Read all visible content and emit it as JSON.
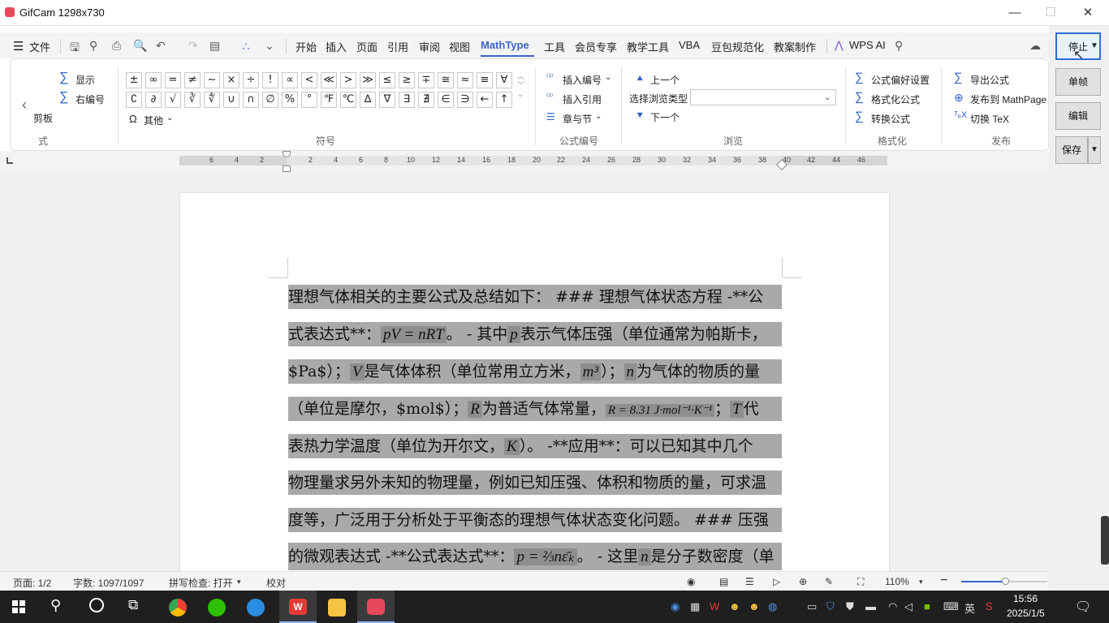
{
  "window": {
    "title": "GifCam 1298x730"
  },
  "menu": {
    "file": "文件",
    "items": [
      "开始",
      "插入",
      "页面",
      "引用",
      "审阅",
      "视图",
      "MathType",
      "工具",
      "会员专享",
      "教学工具",
      "VBA",
      "豆包规范化",
      "教案制作"
    ],
    "ai": "WPS AI"
  },
  "ribbon": {
    "left": {
      "show": "显示",
      "right_number": "右编号",
      "clip_partial": "剪板",
      "style_partial": "式"
    },
    "symbols": {
      "row1": [
        "±",
        "∞",
        "=",
        "≠",
        "~",
        "×",
        "÷",
        "!",
        "∝",
        "<",
        "≪",
        ">",
        "≫",
        "≤",
        "≥",
        "∓",
        "≅",
        "≈",
        "≡",
        "∀"
      ],
      "row2": [
        "∁",
        "∂",
        "√",
        "∛",
        "∜",
        "∪",
        "∩",
        "∅",
        "%",
        "°",
        "℉",
        "℃",
        "∆",
        "∇",
        "∃",
        "∄",
        "∈",
        "∋",
        "←",
        "↑"
      ],
      "other": "其他",
      "caption": "符号"
    },
    "numbering": {
      "insert_number": "插入编号",
      "insert_ref": "插入引用",
      "chapter": "章与节",
      "caption": "公式编号"
    },
    "browse": {
      "prev": "上一个",
      "select_type": "选择浏览类型",
      "next": "下一个",
      "caption": "浏览"
    },
    "format": {
      "prefs": "公式偏好设置",
      "format_eq": "格式化公式",
      "convert": "转换公式",
      "caption": "格式化"
    },
    "publish": {
      "export": "导出公式",
      "mathpage": "发布到 MathPage",
      "tex": "切换 TeX",
      "caption": "发布"
    }
  },
  "ruler": {
    "ticks_left": [
      "6",
      "4",
      "2"
    ],
    "ticks_right": [
      "2",
      "4",
      "6",
      "8",
      "10",
      "12",
      "14",
      "16",
      "18",
      "20",
      "22",
      "24",
      "26",
      "28",
      "30",
      "32",
      "34",
      "36",
      "38",
      "40",
      "42",
      "44",
      "46"
    ]
  },
  "doc": {
    "l1": "理想气体相关的主要公式及总结如下： ### 理想气体状态方程 -**公",
    "l2a": "式表达式**：",
    "l2eq": "pV = nRT",
    "l2b": "。 - 其中",
    "l2p": "p",
    "l2c": "表示气体压强（单位通常为帕斯卡，",
    "l3a": "$Pa$）；",
    "l3V": "V",
    "l3b": "是气体体积（单位常用立方米，",
    "l3m": "m³",
    "l3c": "）；",
    "l3n": "n",
    "l3d": "为气体的物质的量",
    "l4a": "（单位是摩尔，$mol$）；",
    "l4R": "R",
    "l4b": "为普适气体常量，",
    "l4eq": "R = 8.31 J·mol⁻¹·K⁻¹",
    "l4c": "；",
    "l4T": "T",
    "l4d": "代",
    "l5a": "表热力学温度（单位为开尔文，",
    "l5K": "K",
    "l5b": "）。 -**应用**：可以已知其中几个",
    "l6": "物理量求另外未知的物理量，例如已知压强、体积和物质的量，可求温",
    "l7": "度等，广泛用于分析处于平衡态的理想气体状态变化问题。 ### 压强",
    "l8a": "的微观表达式 -**公式表达式**：",
    "l8eq": "p = ⅔nε̄ₖ",
    "l8b": "。 - 这里",
    "l8n": "n",
    "l8c": "是分子数密度（单"
  },
  "status": {
    "page": "页面: 1/2",
    "words": "字数: 1097/1097",
    "spell": "拼写检查: 打开",
    "proof": "校对",
    "zoom": "110%"
  },
  "gifcam": {
    "stop": "停止",
    "single": "单帧",
    "edit": "编辑",
    "save": "保存"
  },
  "taskbar": {
    "ime": "英",
    "time": "15:56",
    "date": "2025/1/5"
  }
}
